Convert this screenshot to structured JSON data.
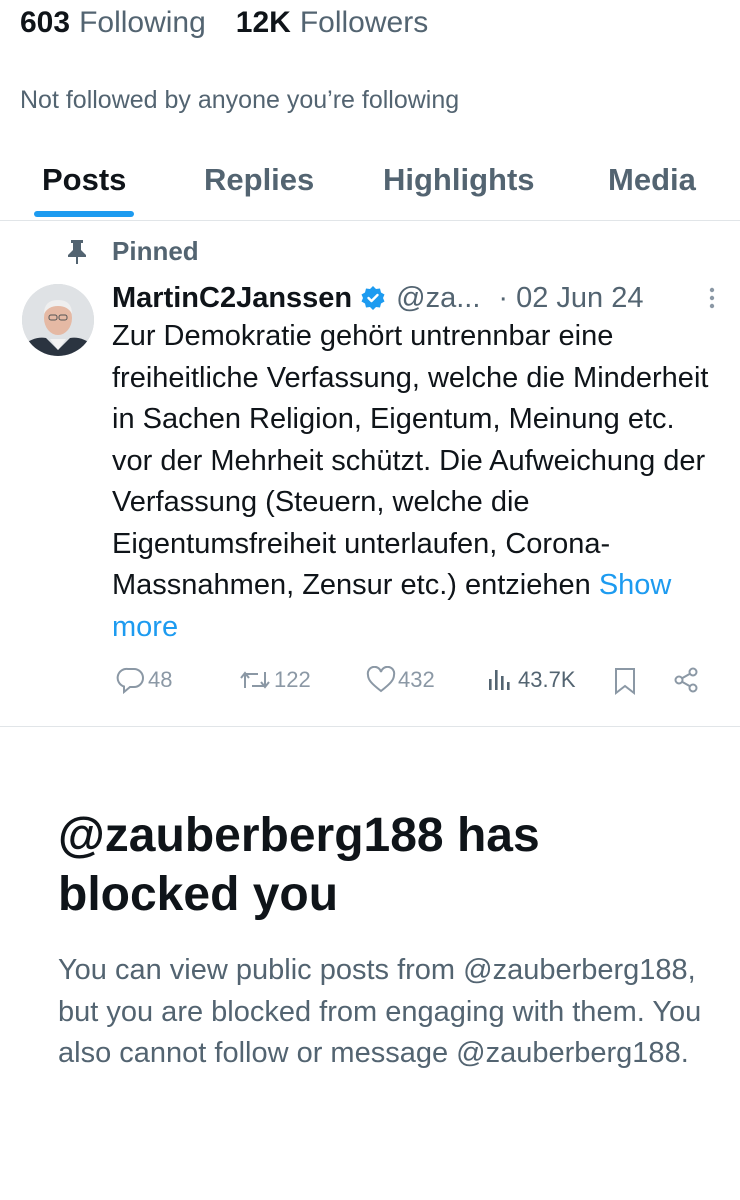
{
  "profile": {
    "following_count": "603",
    "following_label": "Following",
    "followers_count": "12K",
    "followers_label": "Followers",
    "followed_by_note": "Not followed by anyone you’re following"
  },
  "tabs": [
    {
      "label": "Posts",
      "active": true
    },
    {
      "label": "Replies",
      "active": false
    },
    {
      "label": "Highlights",
      "active": false
    },
    {
      "label": "Media",
      "active": false
    }
  ],
  "pinned_post": {
    "pinned_label": "Pinned",
    "author_name": "MartinC2Janssen",
    "handle": "@za...",
    "separator": "·",
    "date": "02 Jun 24",
    "text": "Zur Demokratie gehört untrennbar eine freiheitliche Verfassung, welche die Minderheit in Sachen Religion, Eigentum, Meinung etc. vor der Mehrheit schützt. Die Aufweichung der Verfassung (Steuern, welche die Eigentumsfreiheit unterlaufen, Corona-Massnahmen, Zensur etc.) entziehen",
    "show_more": "Show more",
    "replies": "48",
    "reposts": "122",
    "likes": "432",
    "views": "43.7K"
  },
  "blocked": {
    "title": "@zauberberg188 has blocked you",
    "description": "You can view public posts from @zauberberg188, but you are blocked from engaging with them. You also cannot follow or message @zauberberg188."
  },
  "colors": {
    "accent": "#1d9bf0",
    "text_primary": "#0f1419",
    "text_secondary": "#536471",
    "border": "#e1e5e8"
  }
}
